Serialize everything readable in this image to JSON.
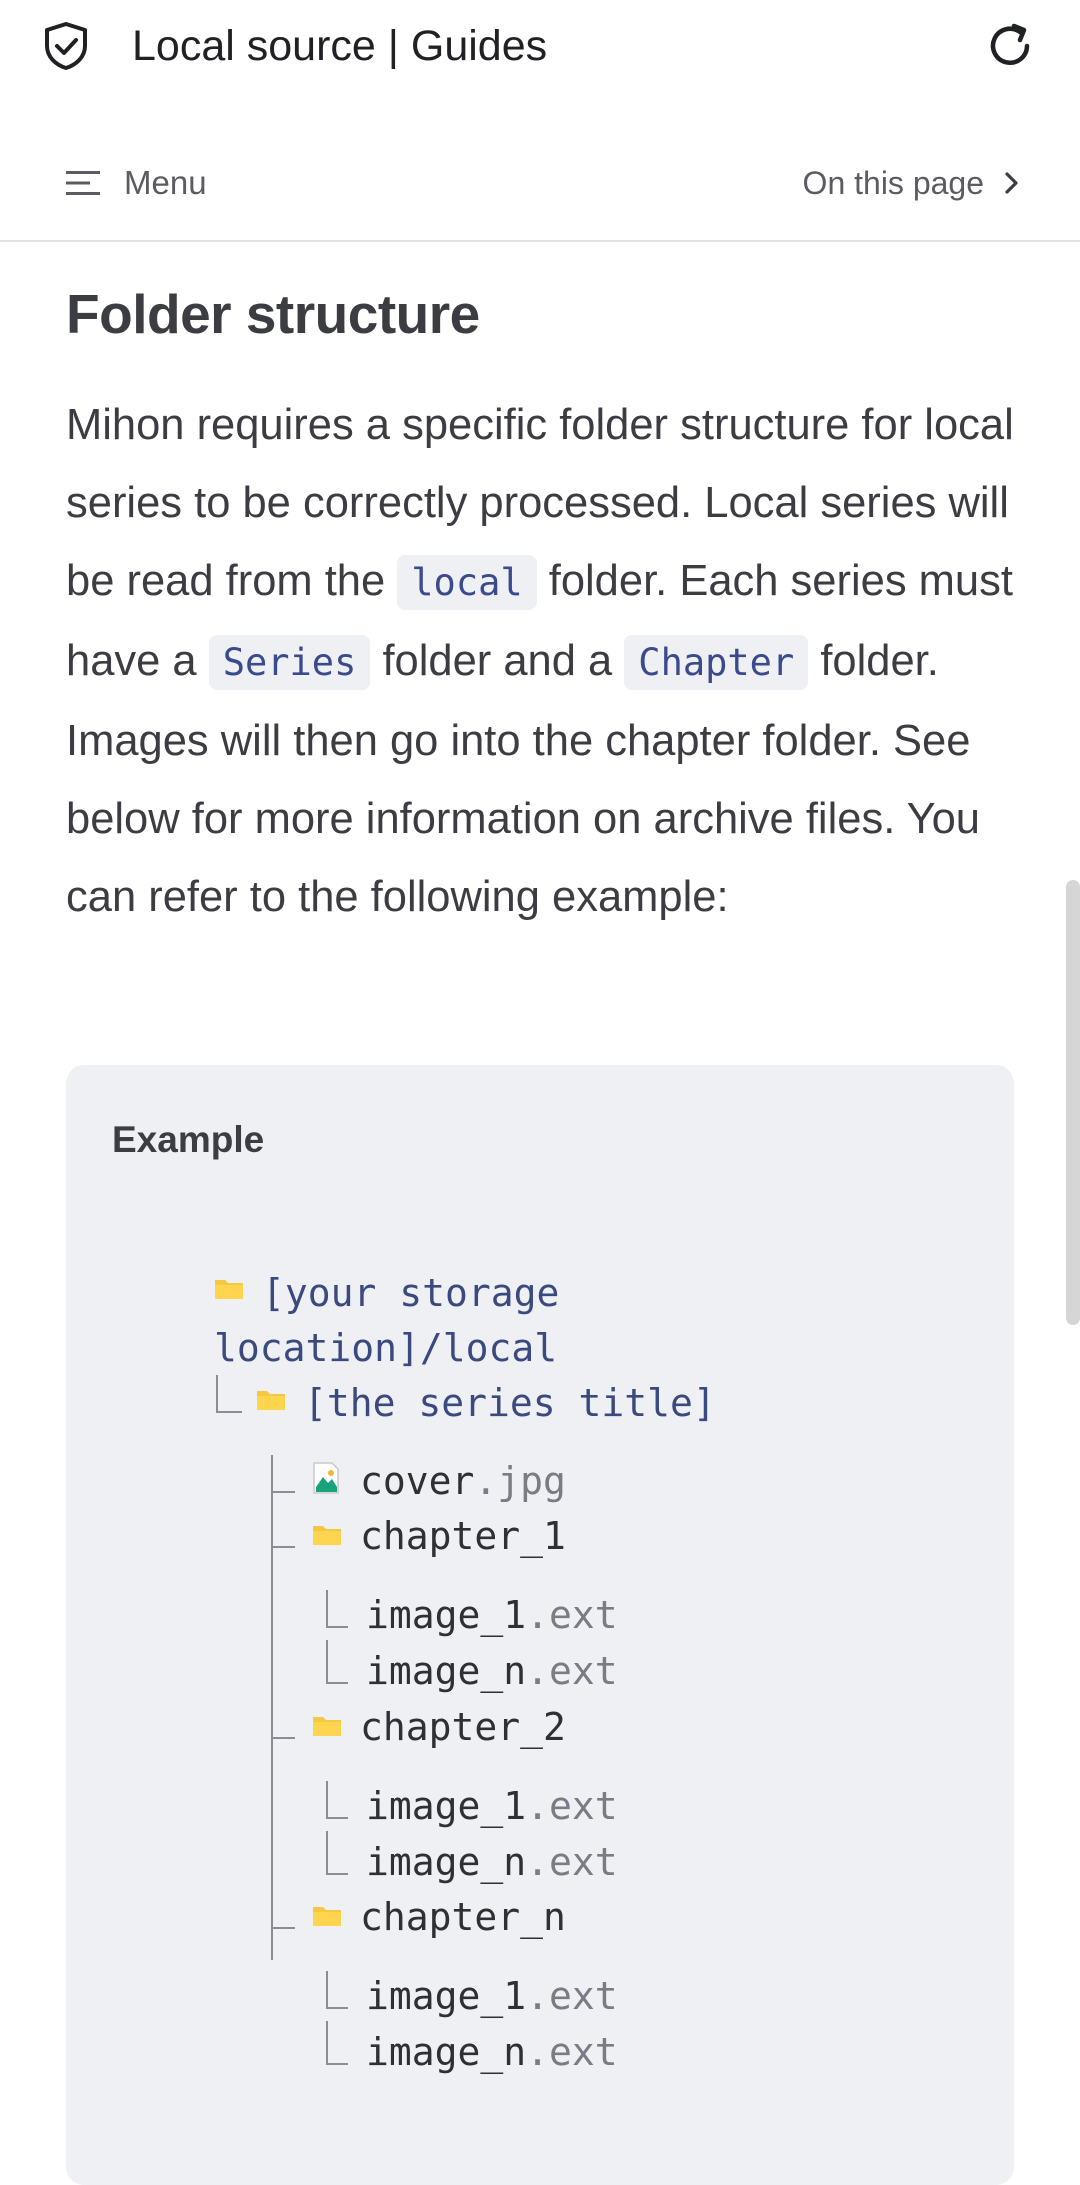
{
  "browser": {
    "title": "Local source | Guides"
  },
  "nav": {
    "menu_label": "Menu",
    "outline_label": "On this page"
  },
  "section": {
    "heading": "Folder structure",
    "paragraph": [
      {
        "type": "text",
        "value": "Mihon requires a specific folder structure for local series to be correctly processed. Local series will be read from the "
      },
      {
        "type": "code",
        "value": "local"
      },
      {
        "type": "text",
        "value": " folder. Each series must have a "
      },
      {
        "type": "code",
        "value": "Series"
      },
      {
        "type": "text",
        "value": " folder and a "
      },
      {
        "type": "code",
        "value": "Chapter"
      },
      {
        "type": "text",
        "value": " folder. Images will then go into the chapter folder. See below for more information on archive files. You can refer to the following example:"
      }
    ]
  },
  "example": {
    "title": "Example",
    "root_line1": "[your storage",
    "root_line2": "location]/local",
    "series": "[the series title]",
    "cover": {
      "name": "cover",
      "ext": ".jpg"
    },
    "chapters": [
      {
        "name": "chapter_1",
        "files": [
          {
            "name": "image_1",
            "ext": ".ext"
          },
          {
            "name": "image_n",
            "ext": ".ext"
          }
        ]
      },
      {
        "name": "chapter_2",
        "files": [
          {
            "name": "image_1",
            "ext": ".ext"
          },
          {
            "name": "image_n",
            "ext": ".ext"
          }
        ]
      },
      {
        "name": "chapter_n",
        "files": [
          {
            "name": "image_1",
            "ext": ".ext"
          },
          {
            "name": "image_n",
            "ext": ".ext"
          }
        ]
      }
    ]
  },
  "colors": {
    "folder": "#f5c842",
    "code_text": "#3a4a8c",
    "code_bg": "#eef0f3",
    "example_bg": "#eef0f4"
  },
  "icons": {
    "site": "shield-check-icon",
    "reload": "reload-icon",
    "menu": "hamburger-icon",
    "outline": "chevron-right-icon",
    "folder": "folder-icon",
    "image": "jpg-image-icon"
  }
}
